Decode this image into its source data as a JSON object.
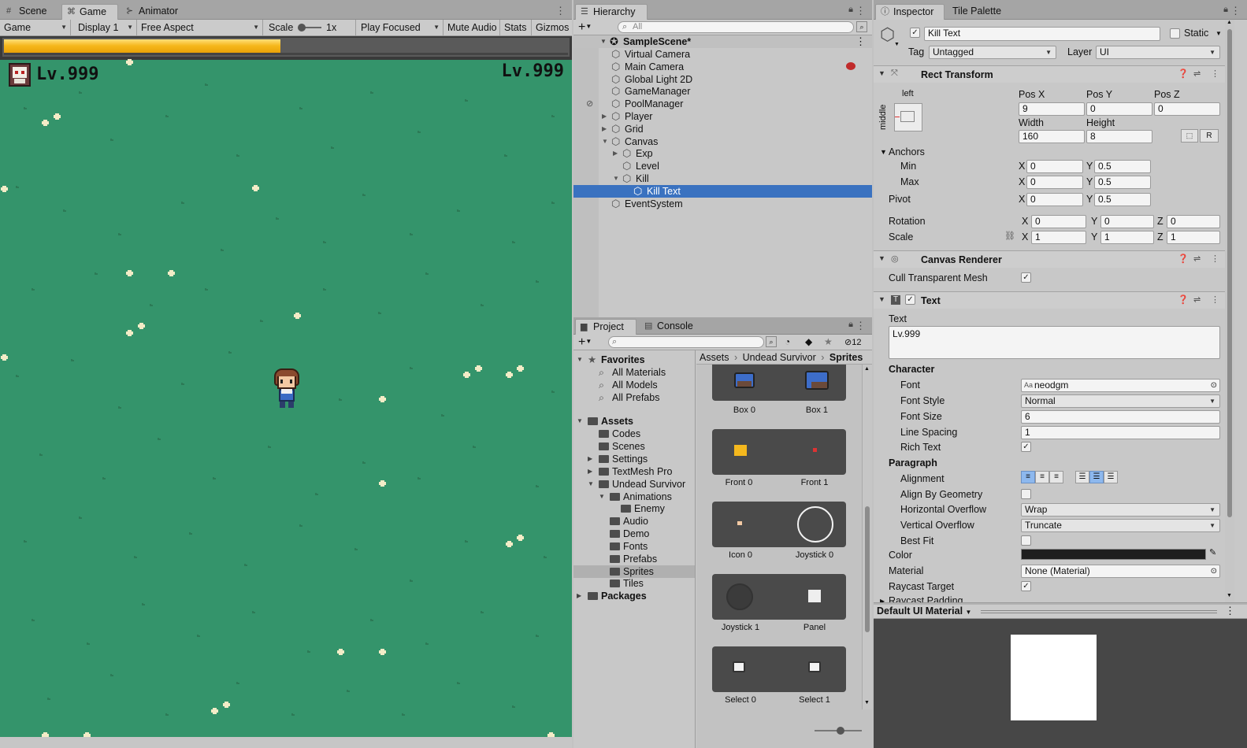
{
  "game_panel": {
    "tabs": [
      {
        "label": "Scene",
        "icon": "scene-icon"
      },
      {
        "label": "Game",
        "icon": "gamepad-icon"
      },
      {
        "label": "Animator",
        "icon": "animator-icon"
      }
    ],
    "toolbar": {
      "display_mode": "Game",
      "display": "Display 1",
      "aspect": "Free Aspect",
      "scale_label": "Scale",
      "scale_value": "1x",
      "play_mode": "Play Focused",
      "mute": "Mute Audio",
      "stats": "Stats",
      "gizmos": "Gizmos"
    },
    "hud": {
      "exp_progress": 0.49,
      "level_left": "Lv.999",
      "level_right": "Lv.999"
    },
    "colors": {
      "grass": "#34946b",
      "exp": "#f6b81c"
    }
  },
  "hierarchy": {
    "tab": "Hierarchy",
    "search_placeholder": "All",
    "scene": "SampleScene*",
    "items": [
      {
        "label": "Virtual Camera",
        "depth": 1,
        "expander": "none"
      },
      {
        "label": "Main Camera",
        "depth": 1,
        "expander": "none"
      },
      {
        "label": "Global Light 2D",
        "depth": 1,
        "expander": "none"
      },
      {
        "label": "GameManager",
        "depth": 1,
        "expander": "none"
      },
      {
        "label": "PoolManager",
        "depth": 1,
        "expander": "none"
      },
      {
        "label": "Player",
        "depth": 1,
        "expander": "collapsed"
      },
      {
        "label": "Grid",
        "depth": 1,
        "expander": "collapsed"
      },
      {
        "label": "Canvas",
        "depth": 1,
        "expander": "expanded"
      },
      {
        "label": "Exp",
        "depth": 2,
        "expander": "collapsed"
      },
      {
        "label": "Level",
        "depth": 2,
        "expander": "none"
      },
      {
        "label": "Kill",
        "depth": 2,
        "expander": "expanded"
      },
      {
        "label": "Kill Text",
        "depth": 3,
        "expander": "none",
        "selected": true
      },
      {
        "label": "EventSystem",
        "depth": 1,
        "expander": "none"
      }
    ]
  },
  "project": {
    "tabs": [
      "Project",
      "Console"
    ],
    "hidden_count": "12",
    "breadcrumb": [
      "Assets",
      "Undead Survivor",
      "Sprites"
    ],
    "tree": [
      {
        "label": "Favorites",
        "depth": 0,
        "expander": "expanded",
        "kind": "star",
        "bold": true
      },
      {
        "label": "All Materials",
        "depth": 1,
        "expander": "none",
        "kind": "search"
      },
      {
        "label": "All Models",
        "depth": 1,
        "expander": "none",
        "kind": "search"
      },
      {
        "label": "All Prefabs",
        "depth": 1,
        "expander": "none",
        "kind": "search"
      },
      {
        "label": "Assets",
        "depth": 0,
        "expander": "expanded",
        "kind": "folder",
        "bold": true
      },
      {
        "label": "Codes",
        "depth": 1,
        "expander": "none",
        "kind": "folder"
      },
      {
        "label": "Scenes",
        "depth": 1,
        "expander": "none",
        "kind": "folder"
      },
      {
        "label": "Settings",
        "depth": 1,
        "expander": "collapsed",
        "kind": "folder"
      },
      {
        "label": "TextMesh Pro",
        "depth": 1,
        "expander": "collapsed",
        "kind": "folder"
      },
      {
        "label": "Undead Survivor",
        "depth": 1,
        "expander": "expanded",
        "kind": "folder"
      },
      {
        "label": "Animations",
        "depth": 2,
        "expander": "expanded",
        "kind": "folder"
      },
      {
        "label": "Enemy",
        "depth": 3,
        "expander": "none",
        "kind": "folder"
      },
      {
        "label": "Audio",
        "depth": 2,
        "expander": "none",
        "kind": "folder"
      },
      {
        "label": "Demo",
        "depth": 2,
        "expander": "none",
        "kind": "folder"
      },
      {
        "label": "Fonts",
        "depth": 2,
        "expander": "none",
        "kind": "folder"
      },
      {
        "label": "Prefabs",
        "depth": 2,
        "expander": "none",
        "kind": "folder"
      },
      {
        "label": "Sprites",
        "depth": 2,
        "expander": "none",
        "kind": "folder",
        "selected": true
      },
      {
        "label": "Tiles",
        "depth": 2,
        "expander": "none",
        "kind": "folder"
      },
      {
        "label": "Packages",
        "depth": 0,
        "expander": "collapsed",
        "kind": "folder",
        "bold": true
      }
    ],
    "sprites": [
      "Box 0",
      "Box 1",
      "Front 0",
      "Front 1",
      "Icon 0",
      "Joystick 0",
      "Joystick 1",
      "Panel",
      "Select 0",
      "Select 1"
    ]
  },
  "inspector": {
    "tabs": [
      "Inspector",
      "Tile Palette"
    ],
    "object_name": "Kill Text",
    "static_label": "Static",
    "tag_label": "Tag",
    "tag_value": "Untagged",
    "layer_label": "Layer",
    "layer_value": "UI",
    "rect_transform": {
      "title": "Rect Transform",
      "anchor_h": "left",
      "anchor_v": "middle",
      "pos_x_label": "Pos X",
      "pos_x": "9",
      "pos_y_label": "Pos Y",
      "pos_y": "0",
      "pos_z_label": "Pos Z",
      "pos_z": "0",
      "width_label": "Width",
      "width": "160",
      "height_label": "Height",
      "height": "8",
      "r_button": "R",
      "anchors_label": "Anchors",
      "min_label": "Min",
      "min_x": "0",
      "min_y": "0.5",
      "max_label": "Max",
      "max_x": "0",
      "max_y": "0.5",
      "pivot_label": "Pivot",
      "pivot_x": "0",
      "pivot_y": "0.5",
      "rotation_label": "Rotation",
      "rot_x": "0",
      "rot_y": "0",
      "rot_z": "0",
      "scale_label": "Scale",
      "scale_x": "1",
      "scale_y": "1",
      "scale_z": "1",
      "x": "X",
      "y": "Y",
      "z": "Z"
    },
    "canvas_renderer": {
      "title": "Canvas Renderer",
      "cull_label": "Cull Transparent Mesh",
      "cull": true
    },
    "text": {
      "title": "Text",
      "text_label": "Text",
      "text_value": "Lv.999",
      "character_label": "Character",
      "font_label": "Font",
      "font_value": "neodgm",
      "font_style_label": "Font Style",
      "font_style": "Normal",
      "font_size_label": "Font Size",
      "font_size": "6",
      "line_spacing_label": "Line Spacing",
      "line_spacing": "1",
      "rich_text_label": "Rich Text",
      "rich_text": true,
      "paragraph_label": "Paragraph",
      "alignment_label": "Alignment",
      "align_geometry_label": "Align By Geometry",
      "align_geometry": false,
      "h_overflow_label": "Horizontal Overflow",
      "h_overflow": "Wrap",
      "v_overflow_label": "Vertical Overflow",
      "v_overflow": "Truncate",
      "best_fit_label": "Best Fit",
      "best_fit": false,
      "color_label": "Color",
      "color_value": "#1e1e1e",
      "material_label": "Material",
      "material_value": "None (Material)",
      "raycast_target_label": "Raycast Target",
      "raycast_target": true,
      "raycast_padding_label": "Raycast Padding"
    },
    "material_preview": {
      "name": "Default UI Material"
    }
  }
}
